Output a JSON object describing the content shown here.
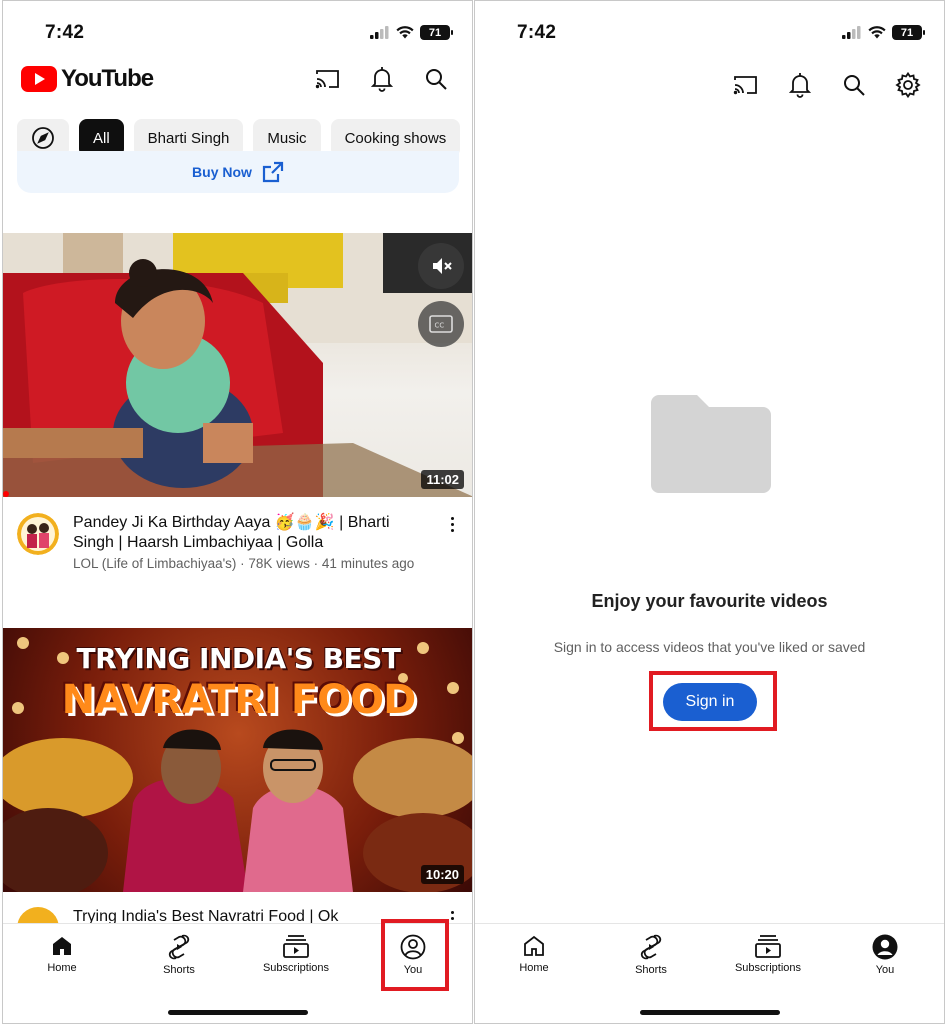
{
  "left": {
    "status": {
      "time": "7:42",
      "battery": "71"
    },
    "logo_text": "YouTube",
    "chips": [
      "All",
      "Bharti Singh",
      "Music",
      "Cooking shows"
    ],
    "promo": {
      "buy_now": "Buy Now"
    },
    "videos": [
      {
        "title": "Pandey Ji Ka Birthday Aaya 🥳🧁🎉 | Bharti Singh | Haarsh Limbachiyaa | Golla",
        "meta": "LOL (Life of Limbachiyaa's) · 78K views · 41 minutes ago",
        "duration": "11:02"
      },
      {
        "title": "Trying India's Best Navratri Food | Ok",
        "thumb_line1": "TRYING INDIA'S BEST",
        "thumb_line2": "NAVRATRI FOOD",
        "duration": "10:20"
      }
    ],
    "nav": [
      "Home",
      "Shorts",
      "Subscriptions",
      "You"
    ]
  },
  "right": {
    "status": {
      "time": "7:42",
      "battery": "71"
    },
    "empty_title": "Enjoy your favourite videos",
    "empty_subtitle": "Sign in to access videos that you've liked or saved",
    "signin_label": "Sign in",
    "nav": [
      "Home",
      "Shorts",
      "Subscriptions",
      "You"
    ]
  },
  "colors": {
    "brand_red": "#FF0000",
    "accent_blue": "#1A5FD1",
    "highlight": "#E11B22"
  }
}
